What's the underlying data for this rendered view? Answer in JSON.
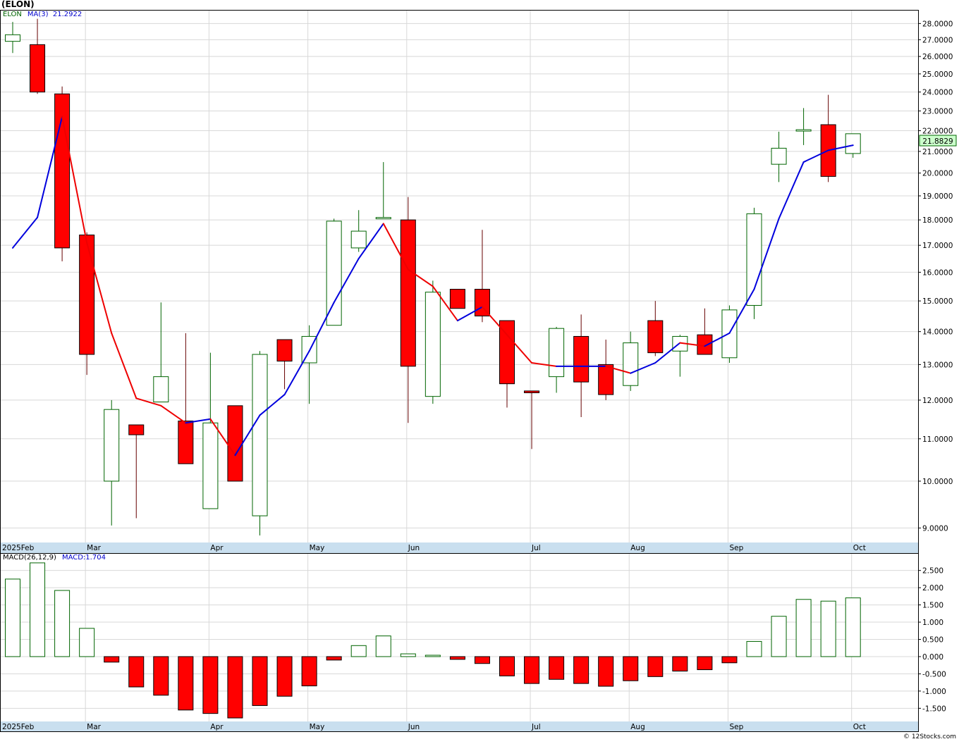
{
  "header": {
    "ticker": "(ELON)",
    "symbol": "ELON",
    "ma_label": "MA(3)",
    "ma_value": "21.2922",
    "macd_label": "MACD(26,12,9)",
    "macd_value_label": "MACD:1.704",
    "last_price_label": "21.8829"
  },
  "footer": {
    "copyright": "© 12Stocks.com"
  },
  "colors": {
    "up_border": "#006400",
    "down_fill": "#ff0000",
    "ma_up": "#0000dd",
    "ma_down": "#ee0000",
    "grid": "#d8d8d8",
    "axis_band": "#c9dfef",
    "last_price_bg": "#ccffcc"
  },
  "chart_data": [
    {
      "type": "candlestick",
      "title": "(ELON)",
      "scale": "log",
      "ylim": [
        8.85,
        28.6
      ],
      "y_ticks": [
        "9.0000",
        "10.0000",
        "11.0000",
        "12.0000",
        "13.0000",
        "14.0000",
        "15.0000",
        "16.0000",
        "17.0000",
        "18.0000",
        "19.0000",
        "20.0000",
        "21.0000",
        "22.0000",
        "23.0000",
        "24.0000",
        "25.0000",
        "26.0000",
        "27.0000",
        "28.0000"
      ],
      "x_tick_labels": [
        "2025Feb",
        "Mar",
        "Apr",
        "May",
        "Jun",
        "Jul",
        "Aug",
        "Sep",
        "Oct"
      ],
      "x_tick_weeks": [
        0,
        3,
        8,
        12,
        16,
        21,
        25,
        29,
        34
      ],
      "candles": [
        {
          "o": 26.9,
          "h": 28.1,
          "l": 26.2,
          "c": 27.3
        },
        {
          "o": 26.7,
          "h": 28.3,
          "l": 23.9,
          "c": 24.0
        },
        {
          "o": 23.9,
          "h": 24.3,
          "l": 16.4,
          "c": 16.9
        },
        {
          "o": 17.4,
          "h": 17.5,
          "l": 12.7,
          "c": 13.3
        },
        {
          "o": 10.0,
          "h": 12.0,
          "l": 9.05,
          "c": 11.75
        },
        {
          "o": 11.35,
          "h": 11.35,
          "l": 9.2,
          "c": 11.1
        },
        {
          "o": 11.95,
          "h": 14.95,
          "l": 11.95,
          "c": 12.65
        },
        {
          "o": 11.45,
          "h": 13.95,
          "l": 10.4,
          "c": 10.4
        },
        {
          "o": 9.4,
          "h": 13.35,
          "l": 9.4,
          "c": 11.4
        },
        {
          "o": 11.85,
          "h": 11.85,
          "l": 10.0,
          "c": 10.0
        },
        {
          "o": 9.25,
          "h": 13.4,
          "l": 8.85,
          "c": 13.3
        },
        {
          "o": 13.75,
          "h": 13.75,
          "l": 12.3,
          "c": 13.1
        },
        {
          "o": 13.05,
          "h": 14.2,
          "l": 11.9,
          "c": 13.85
        },
        {
          "o": 14.2,
          "h": 18.05,
          "l": 14.2,
          "c": 17.95
        },
        {
          "o": 16.9,
          "h": 18.4,
          "l": 16.75,
          "c": 17.55
        },
        {
          "o": 18.05,
          "h": 20.5,
          "l": 18.05,
          "c": 18.1
        },
        {
          "o": 18.0,
          "h": 18.95,
          "l": 11.4,
          "c": 12.95
        },
        {
          "o": 12.1,
          "h": 15.7,
          "l": 11.9,
          "c": 15.3
        },
        {
          "o": 15.4,
          "h": 15.4,
          "l": 14.75,
          "c": 14.75
        },
        {
          "o": 15.4,
          "h": 17.6,
          "l": 14.3,
          "c": 14.5
        },
        {
          "o": 14.35,
          "h": 14.35,
          "l": 11.8,
          "c": 12.45
        },
        {
          "o": 12.25,
          "h": 12.25,
          "l": 10.75,
          "c": 12.2
        },
        {
          "o": 12.65,
          "h": 14.15,
          "l": 12.2,
          "c": 14.1
        },
        {
          "o": 13.85,
          "h": 14.55,
          "l": 11.55,
          "c": 12.5
        },
        {
          "o": 13.0,
          "h": 13.75,
          "l": 12.0,
          "c": 12.15
        },
        {
          "o": 12.4,
          "h": 14.0,
          "l": 12.25,
          "c": 13.65
        },
        {
          "o": 14.35,
          "h": 15.0,
          "l": 13.25,
          "c": 13.35
        },
        {
          "o": 13.4,
          "h": 13.9,
          "l": 12.65,
          "c": 13.85
        },
        {
          "o": 13.9,
          "h": 14.75,
          "l": 13.3,
          "c": 13.3
        },
        {
          "o": 13.2,
          "h": 14.85,
          "l": 13.05,
          "c": 14.7
        },
        {
          "o": 14.85,
          "h": 18.5,
          "l": 14.4,
          "c": 18.25
        },
        {
          "o": 20.4,
          "h": 21.95,
          "l": 19.6,
          "c": 21.15
        },
        {
          "o": 22.0,
          "h": 23.15,
          "l": 21.3,
          "c": 22.05
        },
        {
          "o": 22.3,
          "h": 23.85,
          "l": 19.6,
          "c": 19.85
        },
        {
          "o": 20.9,
          "h": 21.85,
          "l": 20.7,
          "c": 21.85
        }
      ],
      "ma3": [
        16.9,
        18.1,
        22.7,
        17.1,
        13.95,
        12.05,
        11.85,
        11.4,
        11.5,
        10.6,
        11.6,
        12.15,
        13.4,
        14.95,
        16.5,
        17.85,
        16.1,
        15.5,
        14.35,
        14.8,
        13.9,
        13.05,
        12.95,
        12.95,
        12.95,
        12.75,
        13.05,
        13.65,
        13.55,
        13.95,
        15.4,
        18.05,
        20.5,
        21.05,
        21.2922
      ]
    },
    {
      "type": "bar",
      "title": "MACD(26,12,9)",
      "ylim": [
        -1.8,
        2.8
      ],
      "y_ticks": [
        "-1.500",
        "-1.000",
        "-0.500",
        "0.000",
        "0.500",
        "1.000",
        "1.500",
        "2.000",
        "2.500"
      ],
      "values": [
        2.25,
        2.72,
        1.92,
        0.82,
        -0.16,
        -0.88,
        -1.12,
        -1.55,
        -1.65,
        -1.78,
        -1.42,
        -1.15,
        -0.85,
        -0.1,
        0.32,
        0.6,
        0.08,
        0.04,
        -0.08,
        -0.2,
        -0.56,
        -0.78,
        -0.66,
        -0.78,
        -0.86,
        -0.7,
        -0.58,
        -0.42,
        -0.38,
        -0.18,
        0.44,
        1.17,
        1.66,
        1.61,
        1.704
      ]
    }
  ]
}
